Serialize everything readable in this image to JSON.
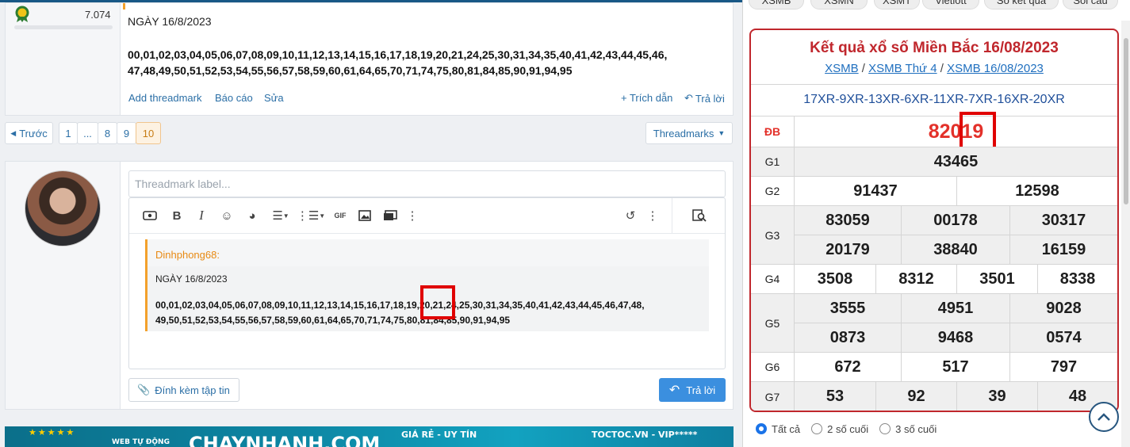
{
  "prev_post": {
    "rank_points": "7.074",
    "date_line": "NGÀY 16/8/2023",
    "numbers_line1": "00,01,02,03,04,05,06,07,08,09,10,11,12,13,14,15,16,17,18,19,20,21,24,25,30,31,34,35,40,41,42,43,44,45,46,",
    "numbers_line2": "47,48,49,50,51,52,53,54,55,56,57,58,59,60,61,64,65,70,71,74,75,80,81,84,85,90,91,94,95",
    "add_threadmark": "Add threadmark",
    "report": "Báo cáo",
    "edit": "Sửa",
    "quote": "+ Trích dẫn",
    "reply": "Trả lời"
  },
  "pagination": {
    "prev": "Trước",
    "pages": [
      "1",
      "...",
      "8",
      "9",
      "10"
    ],
    "current": "10",
    "threadmarks": "Threadmarks"
  },
  "reply_form": {
    "threadmark_placeholder": "Threadmark label...",
    "quote_author": "Dinhphong68:",
    "quote_date": "NGÀY 16/8/2023",
    "quote_line1": "00,01,02,03,04,05,06,07,08,09,10,11,12,13,14,15,16,17,18,19,20,21,24,25,30,31,34,35,40,41,42,43,44,45,46,47,48,",
    "quote_line2": "49,50,51,52,53,54,55,56,57,58,59,60,61,64,65,70,71,74,75,80,81,84,85,90,91,94,95",
    "attach_label": "Đính kèm tập tin",
    "submit_label": "Trả lời"
  },
  "banner": {
    "left_small": "WEB TỰ ĐỘNG",
    "domain": "CHAYNHANH.COM",
    "slogan": "GIÁ RẺ - UY TÍN",
    "right": "TOCTOC.VN - VIP*****"
  },
  "lottery": {
    "chips": [
      "XSMB",
      "XSMN",
      "XSMT",
      "Vietlott",
      "Sổ kết quả",
      "Soi cầu"
    ],
    "title": "Kết quả xổ số Miền Bắc 16/08/2023",
    "links": [
      "XSMB",
      "XSMB Thứ 4",
      "XSMB 16/08/2023"
    ],
    "separator": "/",
    "codes": "17XR-9XR-13XR-6XR-11XR-7XR-16XR-20XR",
    "db_label": "ĐB",
    "db_value": "82019",
    "g1_label": "G1",
    "g1": [
      "43465"
    ],
    "g2_label": "G2",
    "g2": [
      "91437",
      "12598"
    ],
    "g3_label": "G3",
    "g3": [
      "83059",
      "00178",
      "30317",
      "20179",
      "38840",
      "16159"
    ],
    "g4_label": "G4",
    "g4": [
      "3508",
      "8312",
      "3501",
      "8338"
    ],
    "g5_label": "G5",
    "g5": [
      "3555",
      "4951",
      "9028",
      "0873",
      "9468",
      "0574"
    ],
    "g6_label": "G6",
    "g6": [
      "672",
      "517",
      "797"
    ],
    "g7_label": "G7",
    "g7": [
      "53",
      "92",
      "39",
      "48"
    ],
    "filters": [
      "Tất cả",
      "2 số cuối",
      "3 số cuối"
    ],
    "filter_selected": "Tất cả"
  },
  "colors": {
    "accent_red": "#c0272d",
    "link_blue": "#1f6fbf",
    "highlight_box": "#e00000",
    "reply_button": "#3b8fdf"
  }
}
